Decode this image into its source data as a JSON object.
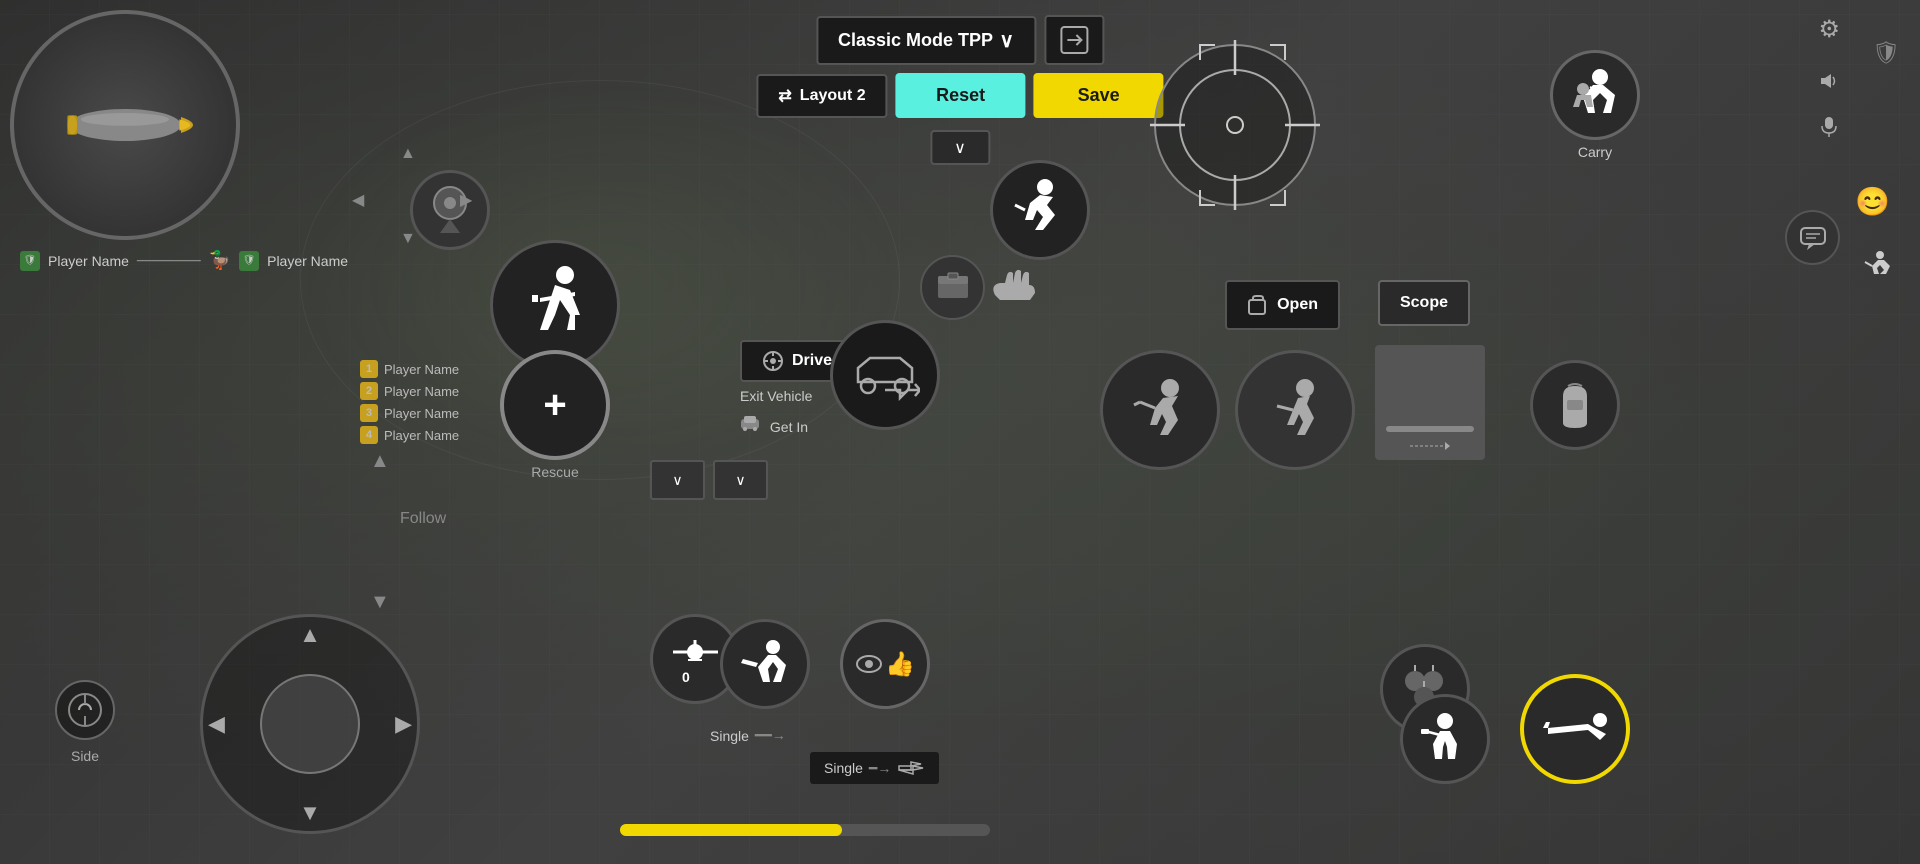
{
  "header": {
    "mode_label": "Classic Mode TPP",
    "export_icon": "⊞",
    "layout_label": "Layout 2",
    "layout_icon": "⇄",
    "reset_label": "Reset",
    "save_label": "Save",
    "chevron_down": "∨"
  },
  "top_right_icons": {
    "settings_icon": "⚙",
    "volume_icon": "🔊",
    "shield_icon": "🛡",
    "mic_icon": "🎤",
    "emoji_icon": "😊",
    "run_icon": "🏃"
  },
  "carry": {
    "label": "Carry"
  },
  "drive": {
    "drive_label": "Drive",
    "exit_vehicle_label": "Exit Vehicle",
    "get_in_label": "Get In"
  },
  "actions": {
    "rescue_label": "Rescue",
    "side_label": "Side",
    "follow_label": "Follow",
    "open_label": "Open",
    "scope_label": "Scope",
    "single_label1": "Single",
    "single_label2": "Single"
  },
  "team": {
    "players": [
      {
        "num": "1",
        "name": "Player Name",
        "color": "#c8a020"
      },
      {
        "num": "2",
        "name": "Player Name",
        "color": "#c8a020"
      },
      {
        "num": "3",
        "name": "Player Name",
        "color": "#c8a020"
      },
      {
        "num": "4",
        "name": "Player Name",
        "color": "#c8a020"
      }
    ]
  },
  "player_names": [
    {
      "name": "Player Name"
    },
    {
      "name": "Player Name"
    }
  ],
  "progress": {
    "fill_percent": 60
  }
}
